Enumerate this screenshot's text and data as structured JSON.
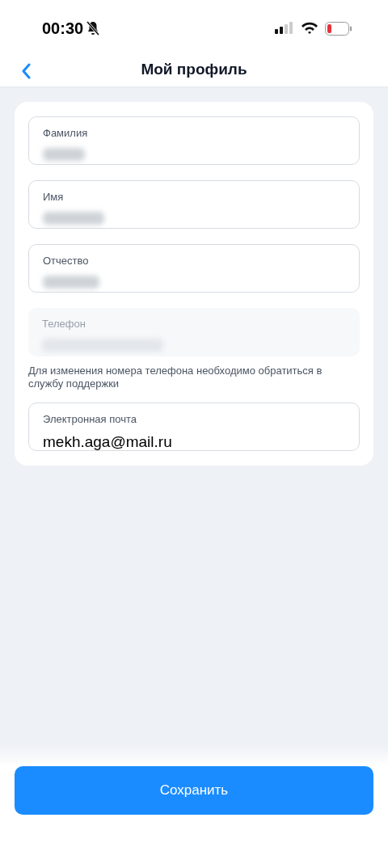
{
  "status_bar": {
    "time": "00:30",
    "silent": true
  },
  "nav": {
    "title": "Мой профиль"
  },
  "fields": [
    {
      "label": "Фамилия",
      "redacted": true,
      "disabled": false
    },
    {
      "label": "Имя",
      "redacted": true,
      "disabled": false
    },
    {
      "label": "Отчество",
      "redacted": true,
      "disabled": false
    },
    {
      "label": "Телефон",
      "redacted": true,
      "disabled": true,
      "hint": "Для изменения номера телефона необходимо обратиться в службу поддержки"
    },
    {
      "label": "Электронная почта",
      "value": "mekh.aga@mail.ru",
      "redacted": false,
      "disabled": false
    }
  ],
  "save_button": "Сохранить"
}
